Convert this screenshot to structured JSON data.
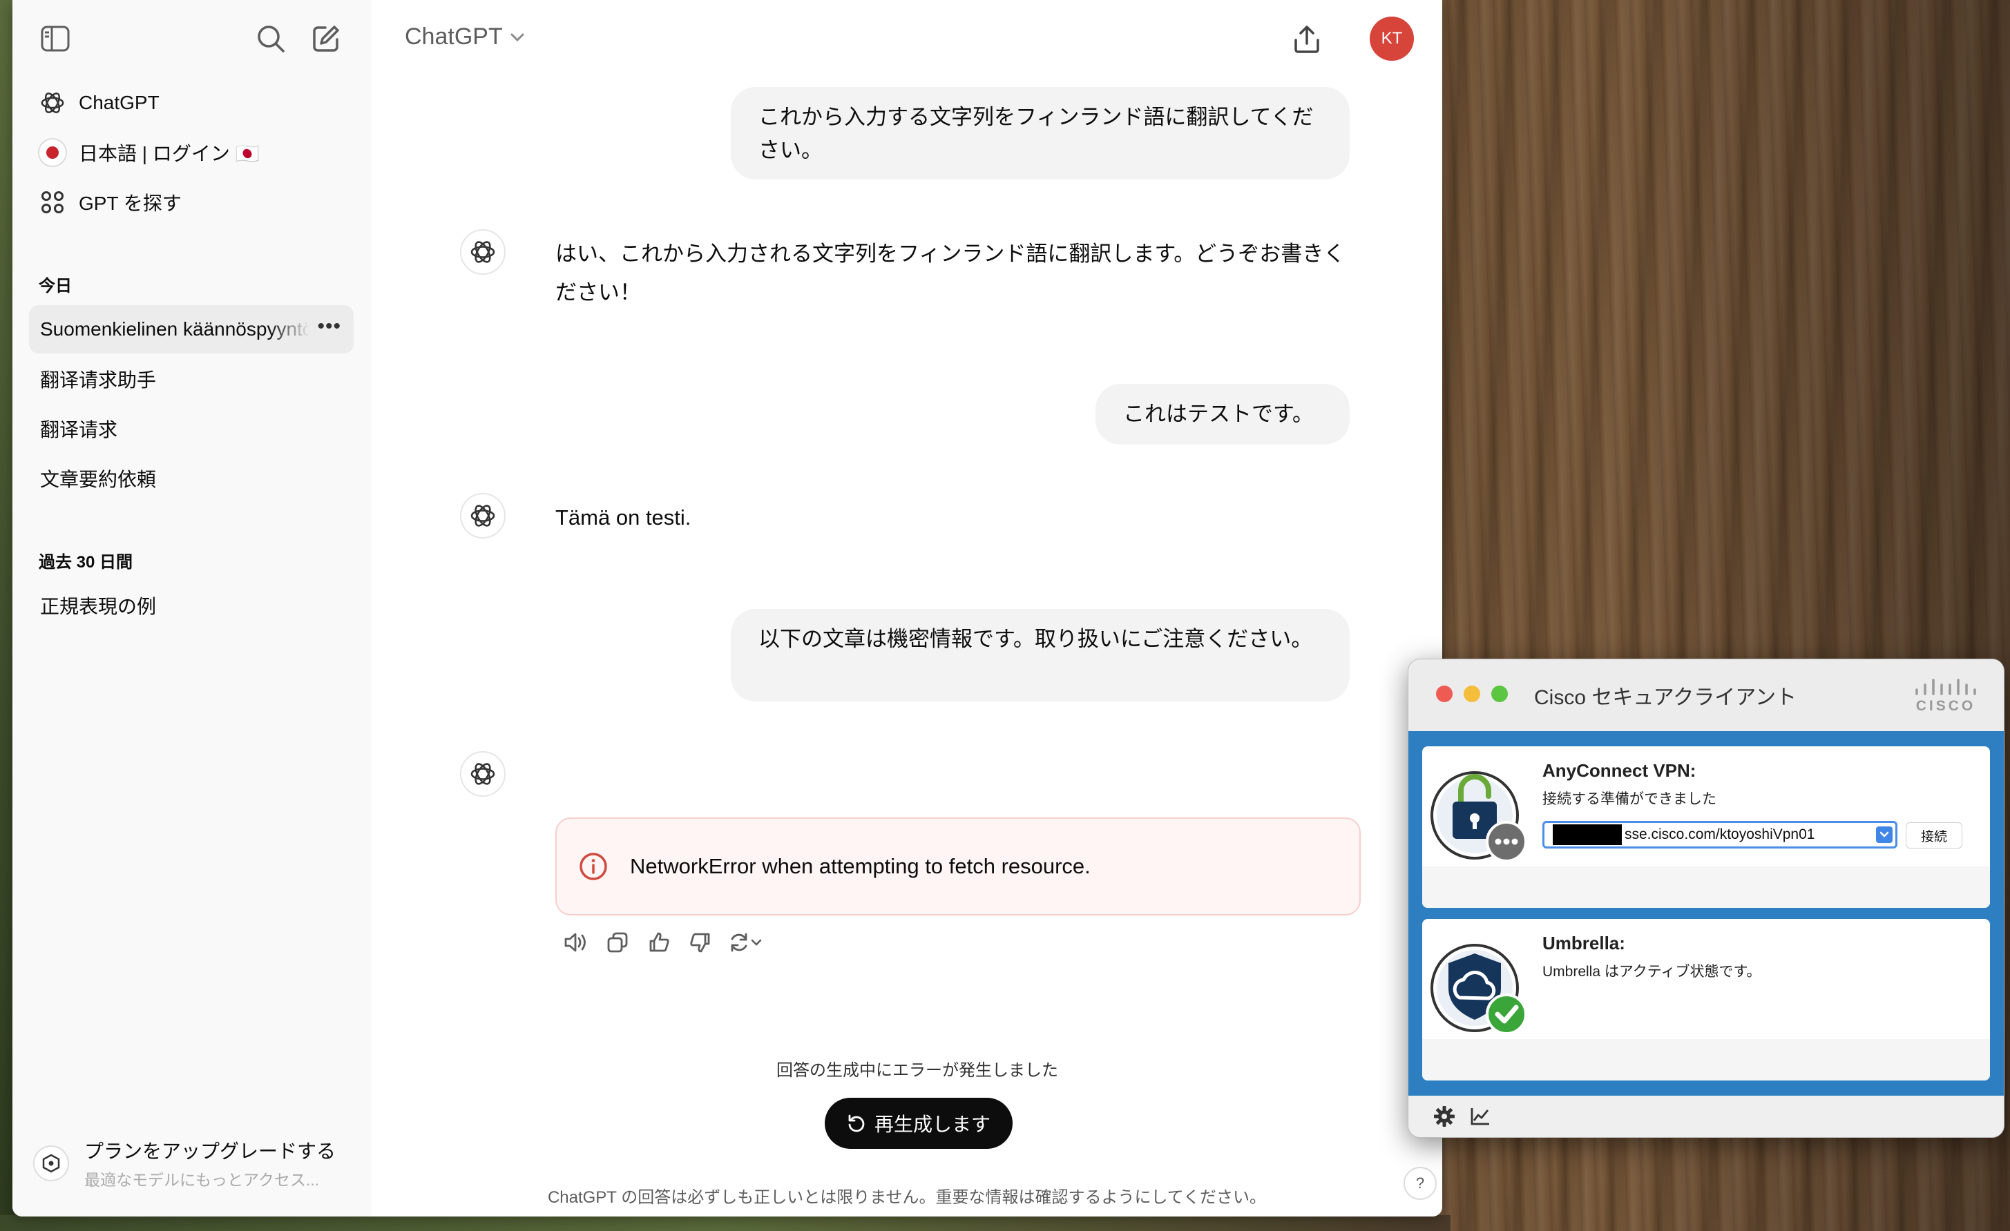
{
  "chat": {
    "sidebar": {
      "nav": [
        {
          "label": "ChatGPT",
          "icon": "chatgpt-logo-icon"
        },
        {
          "label": "日本語 | ログイン 🇯🇵",
          "icon": "japanese-gpt-avatar-icon"
        },
        {
          "label": "GPT を探す",
          "icon": "grid-icon"
        }
      ],
      "section_today": "今日",
      "today": [
        "Suomenkielinen käännöspyyntö",
        "翻译请求助手",
        "翻译请求",
        "文章要約依頼"
      ],
      "section_30d": "過去 30 日間",
      "past30": [
        "正規表現の例"
      ],
      "upgrade_title": "プランをアップグレードする",
      "upgrade_sub": "最適なモデルにもっとアクセス..."
    },
    "header": {
      "model": "ChatGPT",
      "avatar_initials": "KT"
    },
    "messages": {
      "user1": "これから入力する文字列をフィンランド語に翻訳してください。",
      "bot1": "はい、これから入力される文字列をフィンランド語に翻訳します。どうぞお書きください！",
      "user2": "これはテストです。",
      "bot2": "Tämä on testi.",
      "user3": "以下の文章は機密情報です。取り扱いにご注意ください。"
    },
    "error_message": "NetworkError when attempting to fetch resource.",
    "generation_error": "回答の生成中にエラーが発生しました",
    "regenerate_label": "再生成します",
    "disclaimer": "ChatGPT の回答は必ずしも正しいとは限りません。重要な情報は確認するようにしてください。",
    "help": "?"
  },
  "cisco": {
    "title": "Cisco セキュアクライアント",
    "vpn_title": "AnyConnect VPN:",
    "vpn_status": "接続する準備ができました",
    "vpn_server": "sse.cisco.com/ktoyoshiVpn01",
    "connect_label": "接続",
    "umbrella_title": "Umbrella:",
    "umbrella_status": "Umbrella はアクティブ状態です。",
    "logo_text": "CISCO"
  },
  "colors": {
    "avatar_bg": "#d6443a",
    "error_border": "#f6cfcc",
    "error_bg": "#fef5f4",
    "cisco_blue": "#2d7fc1",
    "check_green": "#3aa639"
  }
}
